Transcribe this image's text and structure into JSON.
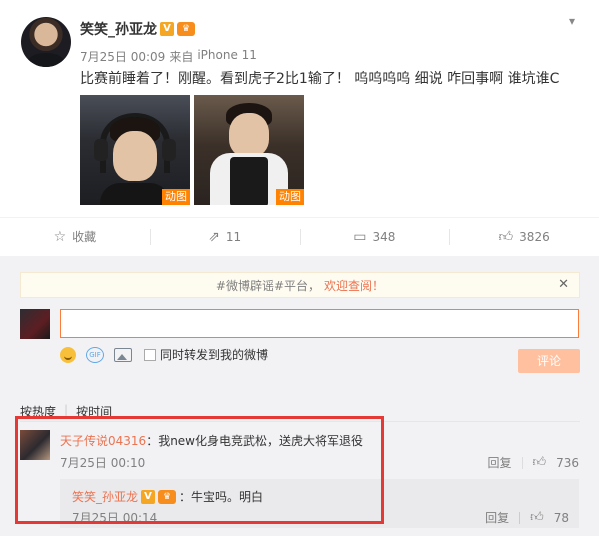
{
  "post": {
    "author": "笑笑_孙亚龙",
    "verified_badge": "V",
    "vip_badge": "♛",
    "time": "7月25日 00:09",
    "source_prefix": "来自",
    "device": "iPhone 11",
    "text": "比赛前睡着了！刚醒。看到虎子2比1输了！ 呜呜呜呜 细说 咋回事啊 谁坑谁C",
    "media": [
      {
        "badge": "动图"
      },
      {
        "badge": "动图"
      }
    ]
  },
  "actions": {
    "favorite": "收藏",
    "repost": "11",
    "comment": "348",
    "like": "3826"
  },
  "icons": {
    "favorite": "star-icon",
    "repost": "share-icon",
    "comment": "comment-icon",
    "like": "thumbs-up-icon",
    "menu": "chevron-down-icon",
    "notice_close": "close-icon"
  },
  "notice": {
    "tag": "#微博辟谣#平台，",
    "link": "欢迎查阅！"
  },
  "composer": {
    "placeholder": "",
    "gif_label": "GIF",
    "checkbox_label": "同时转发到我的微博",
    "submit": "评论"
  },
  "sort": {
    "by_hot": "按热度",
    "by_time": "按时间"
  },
  "comment": {
    "user": "天子传说04316",
    "text": "：我new化身电竞武松，送虎大将军退役",
    "time": "7月25日 00:10",
    "reply_label": "回复",
    "likes": "736",
    "reply": {
      "user": "笑笑_孙亚龙",
      "text": "：牛宝吗。明白",
      "time": "7月25日 00:14",
      "reply_label": "回复",
      "likes": "78"
    }
  },
  "colors": {
    "accent": "#eb7350",
    "submit_disabled": "#ffc09f",
    "highlight_border": "#e53935"
  }
}
